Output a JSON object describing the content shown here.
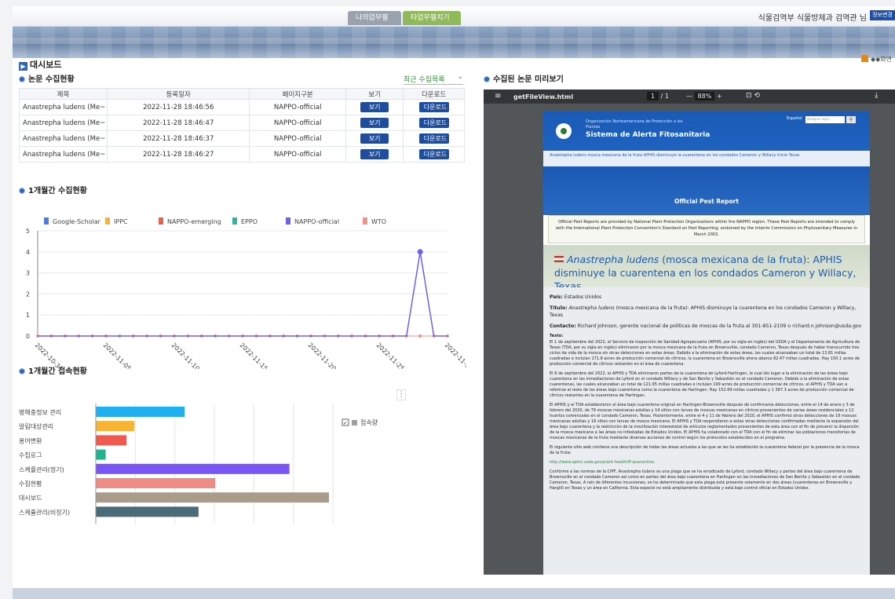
{
  "header": {
    "tabs": [
      {
        "label": "나의업무펼치기"
      },
      {
        "label": "타업무펼치기"
      }
    ],
    "user_text": "식물검역부 식물방제과 검역관 님",
    "user_button": "정보변경"
  },
  "dashboard": {
    "title": "대시보드",
    "home_link": "◆◆화면"
  },
  "papers": {
    "section_title": "논문 수집현황",
    "recent_label": "최근 수집목록",
    "columns": [
      "제목",
      "등록일자",
      "페이지구분",
      "보기",
      "다운로드"
    ],
    "rows": [
      {
        "title": "Anastrepha ludens (Me~",
        "date": "2022-11-28 18:46:56",
        "source": "NAPPO-official",
        "view": "보기",
        "download": "다운로드"
      },
      {
        "title": "Anastrepha ludens (Me~",
        "date": "2022-11-28 18:46:47",
        "source": "NAPPO-official",
        "view": "보기",
        "download": "다운로드"
      },
      {
        "title": "Anastrepha ludens (Me~",
        "date": "2022-11-28 18:46:37",
        "source": "NAPPO-official",
        "view": "보기",
        "download": "다운로드"
      },
      {
        "title": "Anastrepha ludens (Me~",
        "date": "2022-11-28 18:46:27",
        "source": "NAPPO-official",
        "view": "보기",
        "download": "다운로드"
      }
    ]
  },
  "monthly_collect": {
    "section_title": "1개월간 수집현황"
  },
  "monthly_access": {
    "section_title": "1개월간 접속현황",
    "menu_icon": "more-vert-icon"
  },
  "preview": {
    "section_title": "수집된 논문 미리보기",
    "filename": "getFileView.html",
    "page": "1",
    "page_total": "/ 1",
    "zoom": "88%",
    "doc": {
      "org": "Organización Norteamericana de Protección a las Plantas",
      "system": "Sistema de Alerta Fitosanitaria",
      "lang": "Español",
      "search_placeholder": "Busque aquí...",
      "crumb": "Anastrepha ludens mosca mexicana de la fruta APHIS disminuye la cuarentena en los condados Cameron y Willacy Inicio Texas",
      "opr": "Official Pest Report",
      "notice": "Official Pest Reports are provided by National Plant Protection Organizations within the NAPPO region. These Pest Reports are intended to comply with the International Plant Protection Convention's Standard on Pest Reporting, endorsed by the Interim Commission on Phytosanitary Measures in March 2002.",
      "title_italic": "Anastrepha ludens",
      "title_rest": " (mosca mexicana de la fruta):  APHIS disminuye la cuarentena en los condados Cameron y Willacy, Texas",
      "pais_label": "País:",
      "pais": " Estados Unidos",
      "titulo_label": "Título:",
      "titulo_italic": " Anastrepha ludens",
      "titulo": " (mosca mexicana de la fruta):  APHIS disminuye la cuarentena en los condados Cameron y Willacy, Texas",
      "contacto_label": "Contacto:",
      "contacto": " Richard Johnson, gerente nacional de políticas de moscas de la fruta al 301-851-2109 o richard.n.johnson@usda.gov",
      "texto_label": "Texto:",
      "p1": "El 1 de septiembre del 2022, el Servicio de Inspección de Sanidad Agropecuaria (APHIS, por su sigla en inglés) del USDA y el Departamento de Agricultura de Texas (TDA, por su sigla en inglés) eliminaron por la mosca mexicana de la fruta en Brownsville, condado Cameron, Texas después de haber transcurrido tres ciclos de vida de la mosca sin otras detecciones en estas áreas. Debido a la eliminación de estas áreas, las cuales alcanzaban un total de 13.81 millas cuadradas e incluían 171.8 acres de producción comercial de cítricos, la cuarentena en Brownsville ahora abarca 82.47 millas cuadradas. Hay 150.1 acres de producción comercial de cítricos restantes en el área de cuarentena.",
      "p2": "El 8 de septiembre del 2022, el APHIS y TDA eliminaron partes de la cuarentena de Lyford-Harlingen, la cual dio lugar a la eliminación de las áreas bajo cuarentena en las inmediaciones de Lyford en el condado Willacy y de San Benito y Sebastián en el condado Cameron. Debido a la eliminación de estas cuarentenas, las cuales alcanzaban un total de 121.95 millas cuadradas e incluían 199 acres de producción comercial de cítricos, el APHIS y TDA van a referirse al resto de las áreas bajo cuarentena como la cuarentena de Harlingen. Hay 152.69 millas cuadradas y 1 387.3 acres de producción comercial de cítricos restantes en la cuarentena de Harlingen.",
      "p3": "El APHIS y el TDA establecieron el área bajo cuarentena original en Harlingen-Brownsville después de confirmarse detecciones, entre el 14 de enero y 3 de febrero del 2020, de 79 moscas mexicanas adultas y 14 sitios con larvas de moscas mexicanas en cítricos provenientes de varias áreas residenciales y 12 huertos comerciales en el condado Cameron, Texas. Posteriormente, entre el 4 y 11 de febrero del 2020, el APHIS confirmó otras detecciones de 16 moscas mexicanas adultas y 16 sitios con larvas de mosca mexicana. El APHIS y TDA respondieron a estas otras detecciones confirmadas mediante la expansión del área bajo cuarentena y la restricción de la movilización interestatal de artículos reglamentados provenientes de esta área con el fin de prevenir la dispersión de la mosca mexicana a las áreas no infestadas de Estados Unidos. El APHIS ha colaborado con el TDA con el fin de eliminar las poblaciones transitorias de moscas mexicanas de la fruta mediante diversas acciones de control según los protocolos establecidos en el programa.",
      "p4": "El siguiente sitio web contiene una descripción de todas las áreas actuales a las que se les ha establecido la cuarentena federal por la presencia de la mosca de la fruta:",
      "link": "http://www.aphis.usda.gov/plant-health/ff-quarantine.",
      "p5": "Conforme a las normas de la CIPF, Anastrepha ludens es una plaga que se ha erradicado de Lyford, condado Willacy y partes del área bajo cuarentena de Brownsville en el condado Cameron así como en partes del área bajo cuarentena en Harlingen en las inmediaciones de San Benito y Sebastián en el condado Cameron, Texas. A raíz de diferentes incursiones, se ha determinado que esta plaga está presente solamente en dos áreas (cuarentenas en Brownsville y Hargill) en Texas y un área en California. Esta especie no está ampliamente distribuida y está bajo control oficial en Estados Unidos."
    }
  },
  "chart_data": [
    {
      "type": "line",
      "series": [
        {
          "name": "Google-Scholar",
          "color": "#4a7fe0",
          "values": [
            0,
            0,
            0,
            0,
            0,
            0,
            0,
            0,
            0,
            0,
            0,
            0,
            0,
            0,
            0,
            0,
            0,
            0,
            0,
            0,
            0,
            0,
            0,
            0,
            0,
            0,
            0,
            0,
            0,
            0,
            0
          ]
        },
        {
          "name": "IPPC",
          "color": "#f2b43b",
          "values": [
            0,
            0,
            0,
            0,
            0,
            0,
            0,
            0,
            0,
            0,
            0,
            0,
            0,
            0,
            0,
            0,
            0,
            0,
            0,
            0,
            0,
            0,
            0,
            0,
            0,
            0,
            0,
            0,
            0,
            0,
            0
          ]
        },
        {
          "name": "NAPPO-emerging",
          "color": "#e8604c",
          "values": [
            0,
            0,
            0,
            0,
            0,
            0,
            0,
            0,
            0,
            0,
            0,
            0,
            0,
            0,
            0,
            0,
            0,
            0,
            0,
            0,
            0,
            0,
            0,
            0,
            0,
            0,
            0,
            0,
            0,
            0,
            0
          ]
        },
        {
          "name": "EPPO",
          "color": "#2fb5a0",
          "values": [
            0,
            0,
            0,
            0,
            0,
            0,
            0,
            0,
            0,
            0,
            0,
            0,
            0,
            0,
            0,
            0,
            0,
            0,
            0,
            0,
            0,
            0,
            0,
            0,
            0,
            0,
            0,
            0,
            0,
            0,
            0
          ]
        },
        {
          "name": "NAPPO-official",
          "color": "#6a62e8",
          "values": [
            0,
            0,
            0,
            0,
            0,
            0,
            0,
            0,
            0,
            0,
            0,
            0,
            0,
            0,
            0,
            0,
            0,
            0,
            0,
            0,
            0,
            0,
            0,
            0,
            0,
            0,
            0,
            0,
            4,
            0,
            0
          ]
        },
        {
          "name": "WTO",
          "color": "#f0908f",
          "values": [
            0,
            0,
            0,
            0,
            0,
            0,
            0,
            0,
            0,
            0,
            0,
            0,
            0,
            0,
            0,
            0,
            0,
            0,
            0,
            0,
            0,
            0,
            0,
            0,
            0,
            0,
            0,
            0,
            0,
            0,
            0
          ]
        }
      ],
      "x_ticks": [
        "2022-10-31",
        "2022-11-05",
        "2022-11-10",
        "2022-11-15",
        "2022-11-20",
        "2022-11-25",
        "2022-11-30"
      ],
      "ylim": [
        0,
        5
      ],
      "y_ticks": [
        "0",
        "1",
        "2",
        "3",
        "4",
        "5"
      ],
      "legend": "top"
    },
    {
      "type": "bar",
      "orientation": "horizontal",
      "categories": [
        "병해충정보 관리",
        "알림대상관리",
        "용어변환",
        "수집로그",
        "스케쥴관리(정기)",
        "수집현황",
        "대시보드",
        "스케쥴관리(비정기)"
      ],
      "values": [
        450,
        195,
        155,
        50,
        980,
        605,
        1180,
        520
      ],
      "colors": [
        "#1fb0f0",
        "#f7b331",
        "#f05a4e",
        "#1fb593",
        "#7a55f5",
        "#f08c86",
        "#a99c8a",
        "#4a6b78"
      ],
      "series": [
        {
          "name": "접속량"
        }
      ],
      "xlim": [
        0,
        1200
      ],
      "x_ticks": [
        "0",
        "200",
        "400",
        "600",
        "800",
        "1000",
        "1200"
      ],
      "legend": "right"
    }
  ]
}
